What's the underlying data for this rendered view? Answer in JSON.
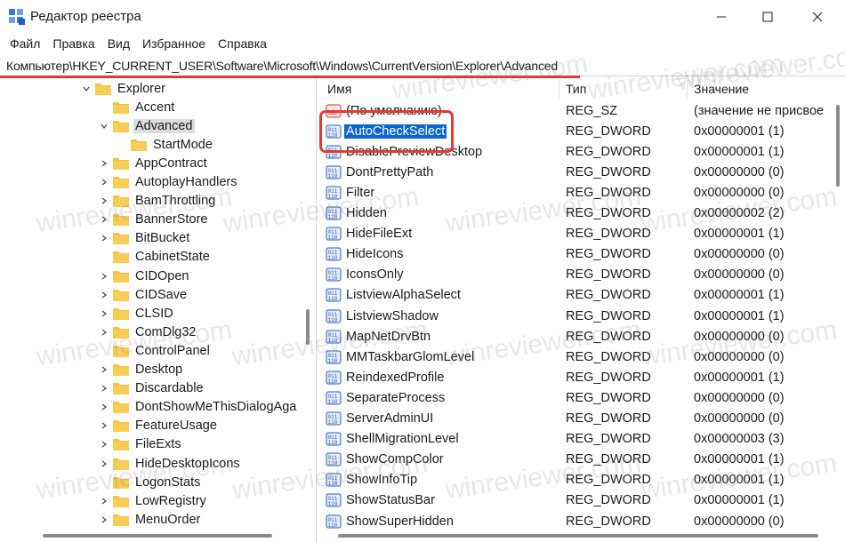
{
  "window": {
    "title": "Редактор реестра",
    "controls": {
      "minimize": "minimize-icon",
      "maximize": "maximize-icon",
      "close": "close-icon"
    }
  },
  "menu": [
    "Файл",
    "Правка",
    "Вид",
    "Избранное",
    "Справка"
  ],
  "address": "Компьютер\\HKEY_CURRENT_USER\\Software\\Microsoft\\Windows\\CurrentVersion\\Explorer\\Advanced",
  "tree": [
    {
      "label": "Explorer",
      "expanded": true
    },
    {
      "label": "Accent",
      "expanded": null
    },
    {
      "label": "Advanced",
      "expanded": true,
      "selected": true
    },
    {
      "label": "StartMode",
      "expanded": null
    },
    {
      "label": "AppContract",
      "expanded": false
    },
    {
      "label": "AutoplayHandlers",
      "expanded": false
    },
    {
      "label": "BamThrottling",
      "expanded": false
    },
    {
      "label": "BannerStore",
      "expanded": false
    },
    {
      "label": "BitBucket",
      "expanded": false
    },
    {
      "label": "CabinetState",
      "expanded": null
    },
    {
      "label": "CIDOpen",
      "expanded": false
    },
    {
      "label": "CIDSave",
      "expanded": false
    },
    {
      "label": "CLSID",
      "expanded": false
    },
    {
      "label": "ComDlg32",
      "expanded": false
    },
    {
      "label": "ControlPanel",
      "expanded": null
    },
    {
      "label": "Desktop",
      "expanded": false
    },
    {
      "label": "Discardable",
      "expanded": false
    },
    {
      "label": "DontShowMeThisDialogAga",
      "expanded": false
    },
    {
      "label": "FeatureUsage",
      "expanded": false
    },
    {
      "label": "FileExts",
      "expanded": false
    },
    {
      "label": "HideDesktopIcons",
      "expanded": false
    },
    {
      "label": "LogonStats",
      "expanded": null
    },
    {
      "label": "LowRegistry",
      "expanded": false
    },
    {
      "label": "MenuOrder",
      "expanded": false
    }
  ],
  "columns": {
    "name": "Имя",
    "type": "Тип",
    "value": "Значение"
  },
  "values": [
    {
      "name": "(По умолчанию)",
      "type": "REG_SZ",
      "value": "(значение не присвое",
      "icon": "string-value-icon"
    },
    {
      "name": "AutoCheckSelect",
      "type": "REG_DWORD",
      "value": "0x00000001 (1)",
      "selected": true
    },
    {
      "name": "DisablePreviewDesktop",
      "type": "REG_DWORD",
      "value": "0x00000001 (1)"
    },
    {
      "name": "DontPrettyPath",
      "type": "REG_DWORD",
      "value": "0x00000000 (0)"
    },
    {
      "name": "Filter",
      "type": "REG_DWORD",
      "value": "0x00000000 (0)"
    },
    {
      "name": "Hidden",
      "type": "REG_DWORD",
      "value": "0x00000002 (2)"
    },
    {
      "name": "HideFileExt",
      "type": "REG_DWORD",
      "value": "0x00000001 (1)"
    },
    {
      "name": "HideIcons",
      "type": "REG_DWORD",
      "value": "0x00000000 (0)"
    },
    {
      "name": "IconsOnly",
      "type": "REG_DWORD",
      "value": "0x00000000 (0)"
    },
    {
      "name": "ListviewAlphaSelect",
      "type": "REG_DWORD",
      "value": "0x00000001 (1)"
    },
    {
      "name": "ListviewShadow",
      "type": "REG_DWORD",
      "value": "0x00000001 (1)"
    },
    {
      "name": "MapNetDrvBtn",
      "type": "REG_DWORD",
      "value": "0x00000000 (0)"
    },
    {
      "name": "MMTaskbarGlomLevel",
      "type": "REG_DWORD",
      "value": "0x00000000 (0)"
    },
    {
      "name": "ReindexedProfile",
      "type": "REG_DWORD",
      "value": "0x00000001 (1)"
    },
    {
      "name": "SeparateProcess",
      "type": "REG_DWORD",
      "value": "0x00000000 (0)"
    },
    {
      "name": "ServerAdminUI",
      "type": "REG_DWORD",
      "value": "0x00000000 (0)"
    },
    {
      "name": "ShellMigrationLevel",
      "type": "REG_DWORD",
      "value": "0x00000003 (3)"
    },
    {
      "name": "ShowCompColor",
      "type": "REG_DWORD",
      "value": "0x00000001 (1)"
    },
    {
      "name": "ShowInfoTip",
      "type": "REG_DWORD",
      "value": "0x00000001 (1)"
    },
    {
      "name": "ShowStatusBar",
      "type": "REG_DWORD",
      "value": "0x00000001 (1)"
    },
    {
      "name": "ShowSuperHidden",
      "type": "REG_DWORD",
      "value": "0x00000000 (0)"
    }
  ],
  "watermark": "winreviewer.com",
  "colors": {
    "selection": "#0a64d2",
    "highlight": "#e53935",
    "folder": "#f5c242"
  }
}
